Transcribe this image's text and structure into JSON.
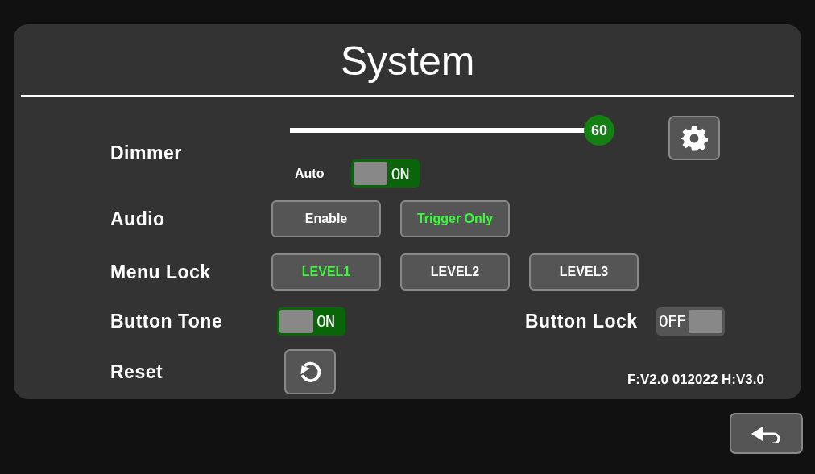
{
  "title": "System",
  "dimmer": {
    "label": "Dimmer",
    "level": 1,
    "reading": "60",
    "auto_label": "Auto",
    "auto": {
      "text": "ON",
      "on": true
    }
  },
  "audio": {
    "label": "Audio",
    "options": [
      {
        "label": "Enable",
        "selected": false
      },
      {
        "label": "Trigger Only",
        "selected": true
      }
    ]
  },
  "menu_lock": {
    "label": "Menu Lock",
    "options": [
      {
        "label": "LEVEL1",
        "selected": true
      },
      {
        "label": "LEVEL2",
        "selected": false
      },
      {
        "label": "LEVEL3",
        "selected": false
      }
    ]
  },
  "button_tone": {
    "label": "Button Tone",
    "toggle": {
      "text": "ON",
      "on": true
    }
  },
  "button_lock": {
    "label": "Button Lock",
    "toggle": {
      "text": "OFF",
      "on": false
    }
  },
  "reset": {
    "label": "Reset"
  },
  "version": "F:V2.0 012022 H:V3.0"
}
